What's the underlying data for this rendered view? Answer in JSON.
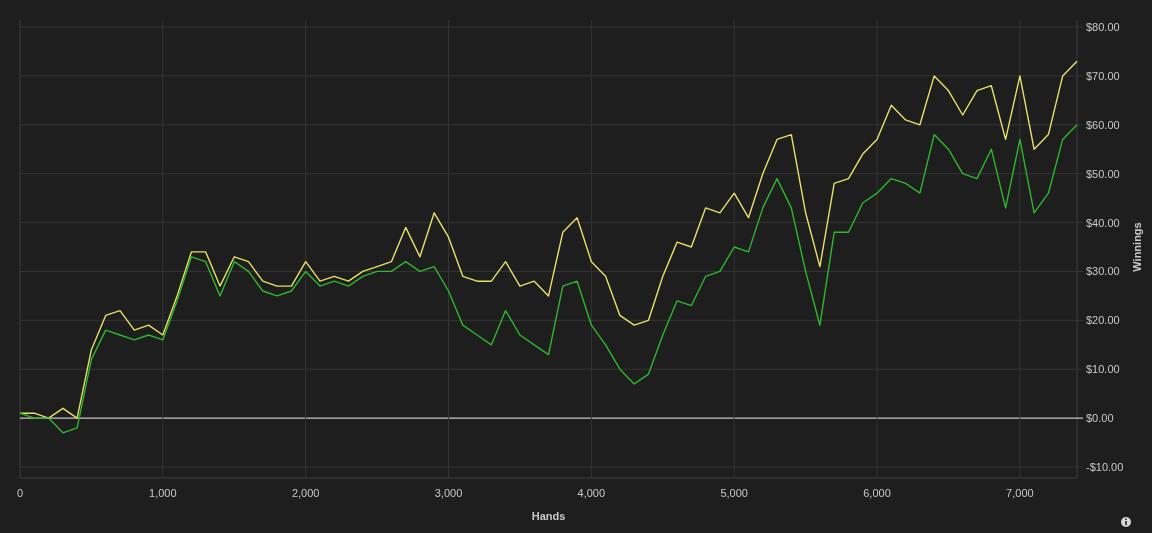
{
  "chart": {
    "chart_data": {
      "type": "line",
      "grid": true,
      "xlabel": "Hands",
      "ylabel": "Winnings",
      "x": [
        0,
        100,
        200,
        300,
        400,
        500,
        600,
        700,
        800,
        900,
        1000,
        1100,
        1200,
        1300,
        1400,
        1500,
        1600,
        1700,
        1800,
        1900,
        2000,
        2100,
        2200,
        2300,
        2400,
        2500,
        2600,
        2700,
        2800,
        2900,
        3000,
        3100,
        3200,
        3300,
        3400,
        3500,
        3600,
        3700,
        3800,
        3900,
        4000,
        4100,
        4200,
        4300,
        4400,
        4500,
        4600,
        4700,
        4800,
        4900,
        5000,
        5100,
        5200,
        5300,
        5400,
        5500,
        5600,
        5700,
        5800,
        5900,
        6000,
        6100,
        6200,
        6300,
        6400,
        6500,
        6600,
        6700,
        6800,
        6900,
        7000,
        7100,
        7200,
        7300,
        7400
      ],
      "series": [
        {
          "color": "#e6e06a",
          "values": [
            1,
            1,
            0,
            2,
            0,
            14,
            21,
            22,
            18,
            19,
            17,
            25,
            34,
            34,
            27,
            33,
            32,
            28,
            27,
            27,
            32,
            28,
            29,
            28,
            30,
            31,
            32,
            39,
            33,
            42,
            37,
            29,
            28,
            28,
            32,
            27,
            28,
            25,
            38,
            41,
            32,
            29,
            21,
            19,
            20,
            29,
            36,
            35,
            43,
            42,
            46,
            41,
            50,
            57,
            58,
            42,
            31,
            48,
            49,
            54,
            57,
            64,
            61,
            60,
            70,
            67,
            62,
            67,
            68,
            57,
            70,
            55,
            58,
            70,
            73
          ]
        },
        {
          "color": "#2fb52f",
          "values": [
            1,
            0,
            0,
            -3,
            -2,
            12,
            18,
            17,
            16,
            17,
            16,
            24,
            33,
            32,
            25,
            32,
            30,
            26,
            25,
            26,
            30,
            27,
            28,
            27,
            29,
            30,
            30,
            32,
            30,
            31,
            26,
            19,
            17,
            15,
            22,
            17,
            15,
            13,
            27,
            28,
            19,
            15,
            10,
            7,
            9,
            17,
            24,
            23,
            29,
            30,
            35,
            34,
            43,
            49,
            43,
            30,
            19,
            38,
            38,
            44,
            46,
            49,
            48,
            46,
            58,
            55,
            50,
            49,
            55,
            43,
            57,
            42,
            46,
            57,
            60
          ]
        }
      ],
      "xlim": [
        0,
        7400
      ],
      "ylim": [
        -10,
        80
      ],
      "xticks": [
        {
          "value": 0,
          "label": "0"
        },
        {
          "value": 1000,
          "label": "1,000"
        },
        {
          "value": 2000,
          "label": "2,000"
        },
        {
          "value": 3000,
          "label": "3,000"
        },
        {
          "value": 4000,
          "label": "4,000"
        },
        {
          "value": 5000,
          "label": "5,000"
        },
        {
          "value": 6000,
          "label": "6,000"
        },
        {
          "value": 7000,
          "label": "7,000"
        }
      ],
      "yticks": [
        {
          "value": -10,
          "label": "-$10.00"
        },
        {
          "value": 0,
          "label": "$0.00"
        },
        {
          "value": 10,
          "label": "$10.00"
        },
        {
          "value": 20,
          "label": "$20.00"
        },
        {
          "value": 30,
          "label": "$30.00"
        },
        {
          "value": 40,
          "label": "$40.00"
        },
        {
          "value": 50,
          "label": "$50.00"
        },
        {
          "value": 60,
          "label": "$60.00"
        },
        {
          "value": 70,
          "label": "$70.00"
        },
        {
          "value": 80,
          "label": "$80.00"
        }
      ]
    }
  }
}
